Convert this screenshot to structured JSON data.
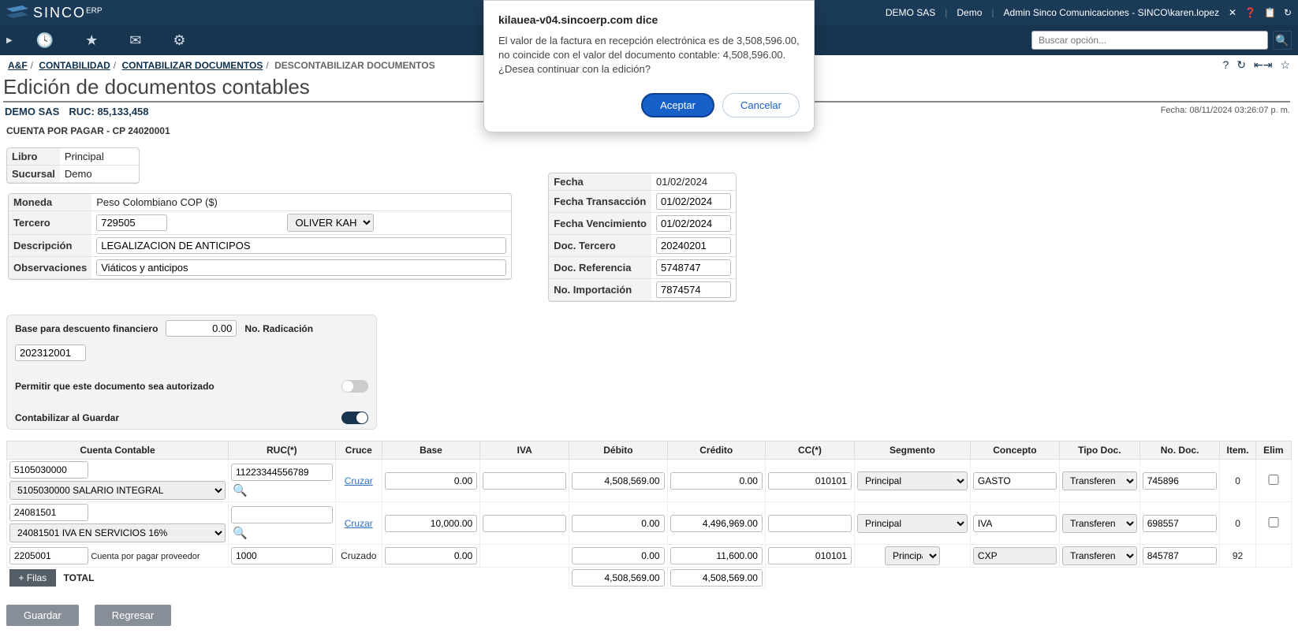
{
  "app": {
    "name": "SINCO",
    "suffix": "ERP"
  },
  "topbar": {
    "company": "DEMO SAS",
    "module": "Demo",
    "user_label": "Admin Sinco Comunicaciones - SINCO\\karen.lopez"
  },
  "search": {
    "placeholder": "Buscar opción..."
  },
  "breadcrumb": {
    "a": "A&F",
    "b": "CONTABILIDAD",
    "c": "CONTABILIZAR DOCUMENTOS",
    "d": "DESCONTABILIZAR DOCUMENTOS"
  },
  "page": {
    "title": "Edición de documentos contables",
    "company": "DEMO SAS",
    "ruc_label": "RUC: 85,133,458",
    "timestamp": "Fecha: 08/11/2024 03:26:07 p. m.",
    "docline": "CUENTA POR PAGAR - CP 24020001"
  },
  "small": {
    "libro_label": "Libro",
    "libro_value": "Principal",
    "sucursal_label": "Sucursal",
    "sucursal_value": "Demo"
  },
  "left": {
    "moneda_label": "Moneda",
    "moneda_value": "Peso Colombiano COP ($)",
    "tercero_label": "Tercero",
    "tercero_code": "729505",
    "tercero_name": "OLIVER KAHN",
    "descripcion_label": "Descripción",
    "descripcion_value": "LEGALIZACION DE ANTICIPOS",
    "obs_label": "Observaciones",
    "obs_value": "Viáticos y anticipos"
  },
  "right": {
    "fecha_label": "Fecha",
    "fecha_value": "01/02/2024",
    "fecha_trans_label": "Fecha Transacción",
    "fecha_trans_value": "01/02/2024",
    "fecha_venc_label": "Fecha Vencimiento",
    "fecha_venc_value": "01/02/2024",
    "doc_tercero_label": "Doc. Tercero",
    "doc_tercero_value": "20240201",
    "doc_ref_label": "Doc. Referencia",
    "doc_ref_value": "5748747",
    "no_imp_label": "No. Importación",
    "no_imp_value": "7874574"
  },
  "mid": {
    "base_label": "Base para descuento financiero",
    "base_value": "0.00",
    "radicacion_label": "No. Radicación",
    "radicacion_value": "202312001",
    "permitir_label": "Permitir que este documento sea autorizado",
    "contab_label": "Contabilizar al Guardar"
  },
  "grid": {
    "headers": {
      "cuenta": "Cuenta Contable",
      "ruc": "RUC(*)",
      "cruce": "Cruce",
      "base": "Base",
      "iva": "IVA",
      "debito": "Débito",
      "credito": "Crédito",
      "cc": "CC(*)",
      "segmento": "Segmento",
      "concepto": "Concepto",
      "tipodoc": "Tipo Doc.",
      "nodoc": "No. Doc.",
      "item": "Item.",
      "elim": "Elim"
    },
    "rows": [
      {
        "cuenta_code": "5105030000",
        "cuenta_sel": "5105030000 SALARIO INTEGRAL",
        "ruc": "11223344556789",
        "cruce": "Cruzar",
        "base": "0.00",
        "iva": "",
        "debito": "4,508,569.00",
        "credito": "0.00",
        "cc": "010101",
        "segmento": "Principal",
        "concepto": "GASTO",
        "tipodoc": "Transferen",
        "nodoc": "745896",
        "item": "0",
        "elim": false
      },
      {
        "cuenta_code": "24081501",
        "cuenta_sel": "24081501 IVA EN SERVICIOS 16%",
        "ruc": "",
        "cruce": "Cruzar",
        "base": "10,000.00",
        "iva": "",
        "debito": "0.00",
        "credito": "4,496,969.00",
        "cc": "",
        "segmento": "Principal",
        "concepto": "IVA",
        "tipodoc": "Transferen",
        "nodoc": "698557",
        "item": "0",
        "elim": false
      },
      {
        "cuenta_code": "2205001",
        "cuenta_sel_text": "Cuenta por pagar proveedor",
        "ruc": "1000",
        "cruce": "Cruzado",
        "base": "0.00",
        "iva": "",
        "debito": "0.00",
        "credito": "11,600.00",
        "cc": "010101",
        "segmento": "Principal",
        "concepto": "CXP",
        "tipodoc": "Transferen",
        "nodoc": "845787",
        "item": "92",
        "elim": null
      }
    ],
    "filas_btn": "+ Filas",
    "total_label": "TOTAL",
    "total_debito": "4,508,569.00",
    "total_credito": "4,508,569.00"
  },
  "buttons": {
    "guardar": "Guardar",
    "regresar": "Regresar"
  },
  "modal": {
    "title": "kilauea-v04.sincoerp.com dice",
    "body": "El valor de la factura en recepción electrónica es de 3,508,596.00, no coincide con el valor del documento contable: 4,508,596.00.\n¿Desea continuar con la edición?",
    "accept": "Aceptar",
    "cancel": "Cancelar"
  }
}
